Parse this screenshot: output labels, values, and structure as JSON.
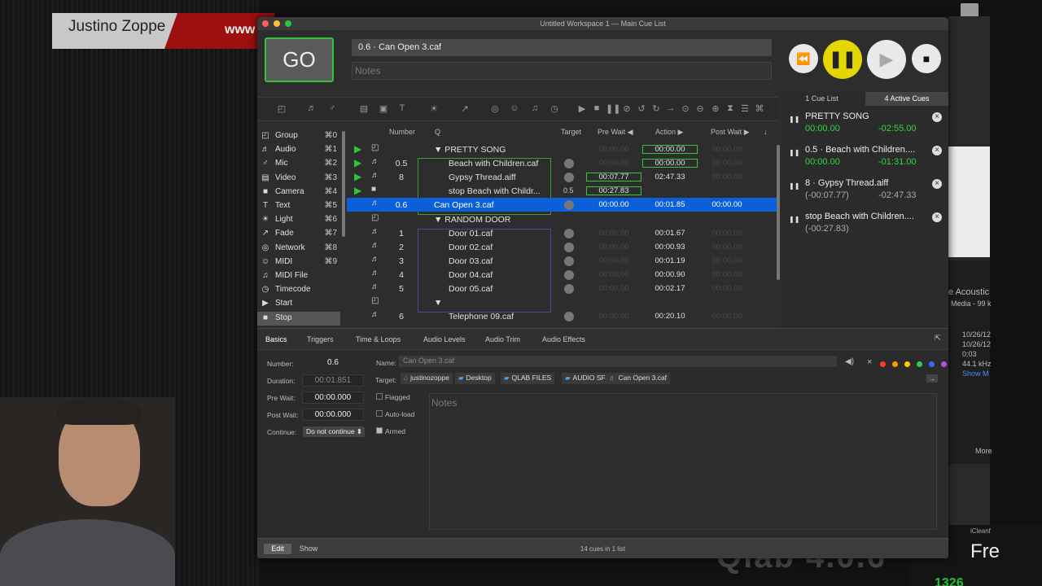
{
  "backdrop": {
    "banner_name": "Justino Zoppe",
    "banner_www": "www",
    "bottom_logo": "Qlab 4.0.6",
    "side_texts": [
      "e Acoustic",
      "Media - 99 k",
      "10/26/12",
      "10/26/12",
      "0:03",
      "44.1 kHz",
      "Show M",
      "More"
    ],
    "bottom_right": {
      "label": "iCleanf",
      "big": "Fre",
      "green": "1326"
    }
  },
  "window": {
    "title": "Untitled Workspace 1 — Main Cue List",
    "go_label": "GO",
    "current_cue": "0.6 · Can Open 3.caf",
    "notes_placeholder": "Notes"
  },
  "transport": {
    "rewind_icon": "⏪",
    "pause_icon": "❚❚",
    "play_icon": "▶",
    "stop_icon": "■"
  },
  "toolbar_icons": [
    "group-icon",
    "audio-icon",
    "mic-icon",
    "video-icon",
    "camera-icon",
    "text-icon",
    "light-icon",
    "fade-icon",
    "network-icon",
    "midi-icon",
    "midi-file-icon",
    "timecode-icon",
    "start-icon",
    "stop-icon",
    "pause-icon",
    "load-icon",
    "reset-icon",
    "devamp-icon",
    "goto-icon",
    "target-icon",
    "arm-icon",
    "disarm-icon",
    "wait-icon",
    "memo-icon",
    "script-icon"
  ],
  "sidebar": {
    "items": [
      {
        "label": "Group",
        "shortcut": "⌘0",
        "icon": "◰"
      },
      {
        "label": "Audio",
        "shortcut": "⌘1",
        "icon": "♬"
      },
      {
        "label": "Mic",
        "shortcut": "⌘2",
        "icon": "♂"
      },
      {
        "label": "Video",
        "shortcut": "⌘3",
        "icon": "▤"
      },
      {
        "label": "Camera",
        "shortcut": "⌘4",
        "icon": "■"
      },
      {
        "label": "Text",
        "shortcut": "⌘5",
        "icon": "T"
      },
      {
        "label": "Light",
        "shortcut": "⌘6",
        "icon": "☀"
      },
      {
        "label": "Fade",
        "shortcut": "⌘7",
        "icon": "↗"
      },
      {
        "label": "Network",
        "shortcut": "⌘8",
        "icon": "◎"
      },
      {
        "label": "MIDI",
        "shortcut": "⌘9",
        "icon": "☺"
      },
      {
        "label": "MIDI File",
        "shortcut": "",
        "icon": "♫"
      },
      {
        "label": "Timecode",
        "shortcut": "",
        "icon": "◷"
      },
      {
        "label": "Start",
        "shortcut": "",
        "icon": "▶"
      },
      {
        "label": "Stop",
        "shortcut": "",
        "icon": "■"
      }
    ]
  },
  "cue_table": {
    "headers": {
      "number": "Number",
      "q": "Q",
      "target": "Target",
      "pre_wait": "Pre Wait",
      "action": "Action",
      "post_wait": "Post Wait"
    },
    "rows": [
      {
        "playing": true,
        "type": "◰",
        "number": "",
        "q": "▼ PRETTY SONG",
        "target": "",
        "pre_wait": "00:00.00",
        "action": "00:00.00",
        "post_wait": "00:00.00",
        "indent": 0
      },
      {
        "playing": true,
        "type": "♬",
        "number": "0.5",
        "q": "Beach with Children.caf",
        "target": "•",
        "pre_wait": "00:00.00",
        "action": "00:00.00",
        "post_wait": "00:00.00",
        "indent": 1
      },
      {
        "playing": true,
        "type": "♬",
        "number": "8",
        "q": "Gypsy Thread.aiff",
        "target": "•",
        "pre_wait": "00:07.77",
        "action": "02:47.33",
        "post_wait": "00:00.00",
        "indent": 1
      },
      {
        "playing": true,
        "type": "■",
        "number": "",
        "q": "stop Beach with Childr...",
        "target": "0.5",
        "pre_wait": "00:27.83",
        "action": "",
        "post_wait": "",
        "indent": 1
      },
      {
        "playing": false,
        "type": "♬",
        "number": "0.6",
        "q": "Can Open 3.caf",
        "target": "•",
        "pre_wait": "00:00.00",
        "action": "00:01.85",
        "post_wait": "00:00.00",
        "indent": 0,
        "selected": true
      },
      {
        "playing": false,
        "type": "◰",
        "number": "",
        "q": "▼ RANDOM DOOR",
        "target": "",
        "pre_wait": "",
        "action": "",
        "post_wait": "",
        "indent": 0
      },
      {
        "playing": false,
        "type": "♬",
        "number": "1",
        "q": "Door 01.caf",
        "target": "•",
        "pre_wait": "00:00.00",
        "action": "00:01.67",
        "post_wait": "00:00.00",
        "indent": 1
      },
      {
        "playing": false,
        "type": "♬",
        "number": "2",
        "q": "Door 02.caf",
        "target": "•",
        "pre_wait": "00:00.00",
        "action": "00:00.93",
        "post_wait": "00:00.00",
        "indent": 1
      },
      {
        "playing": false,
        "type": "♬",
        "number": "3",
        "q": "Door 03.caf",
        "target": "•",
        "pre_wait": "00:00.00",
        "action": "00:01.19",
        "post_wait": "00:00.00",
        "indent": 1
      },
      {
        "playing": false,
        "type": "♬",
        "number": "4",
        "q": "Door 04.caf",
        "target": "•",
        "pre_wait": "00:00.00",
        "action": "00:00.90",
        "post_wait": "00:00.00",
        "indent": 1
      },
      {
        "playing": false,
        "type": "♬",
        "number": "5",
        "q": "Door 05.caf",
        "target": "•",
        "pre_wait": "00:00.00",
        "action": "00:02.17",
        "post_wait": "00:00.00",
        "indent": 1
      },
      {
        "playing": false,
        "type": "◰",
        "number": "",
        "q": "▼",
        "target": "",
        "pre_wait": "",
        "action": "",
        "post_wait": "",
        "indent": 0
      },
      {
        "playing": false,
        "type": "♬",
        "number": "6",
        "q": "Telephone 09.caf",
        "target": "•",
        "pre_wait": "00:00.00",
        "action": "00:20.10",
        "post_wait": "00:00.00",
        "indent": 1
      }
    ]
  },
  "active_cues": {
    "tabs": [
      "1 Cue List",
      "4 Active Cues"
    ],
    "items": [
      {
        "name": "PRETTY SONG",
        "elapsed": "00:00.00",
        "remaining": "-02:55.00",
        "dim": false
      },
      {
        "name": "0.5 · Beach with Children....",
        "elapsed": "00:00.00",
        "remaining": "-01:31.00",
        "dim": false
      },
      {
        "name": "8 · Gypsy Thread.aiff",
        "elapsed": "(-00:07.77)",
        "remaining": "-02:47.33",
        "dim": true
      },
      {
        "name": "stop Beach with Children....",
        "elapsed": "(-00:27.83)",
        "remaining": "",
        "dim": true
      }
    ]
  },
  "inspector": {
    "tabs": [
      "Basics",
      "Triggers",
      "Time & Loops",
      "Audio Levels",
      "Audio Trim",
      "Audio Effects"
    ],
    "number_label": "Number:",
    "number_value": "0.6",
    "duration_label": "Duration:",
    "duration_value": "00:01.851",
    "prewait_label": "Pre Wait:",
    "prewait_value": "00:00.000",
    "postwait_label": "Post Wait:",
    "postwait_value": "00:00.000",
    "continue_label": "Continue:",
    "continue_value": "Do not continue",
    "name_label": "Name:",
    "name_placeholder": "Can Open 3.caf",
    "target_label": "Target:",
    "target_path": [
      "justinozoppe",
      "Desktop",
      "QLAB FILES",
      "AUDIO SFX",
      "Can Open 3.caf"
    ],
    "flagged_label": "Flagged",
    "autoload_label": "Auto-load",
    "armed_label": "Armed",
    "notes_placeholder": "Notes",
    "color_dots": [
      "#ff3b30",
      "#ff9500",
      "#ffcc00",
      "#34c759",
      "#3a66ff",
      "#af52de"
    ]
  },
  "bottom_bar": {
    "edit": "Edit",
    "show": "Show",
    "count": "14 cues in 1 list"
  }
}
